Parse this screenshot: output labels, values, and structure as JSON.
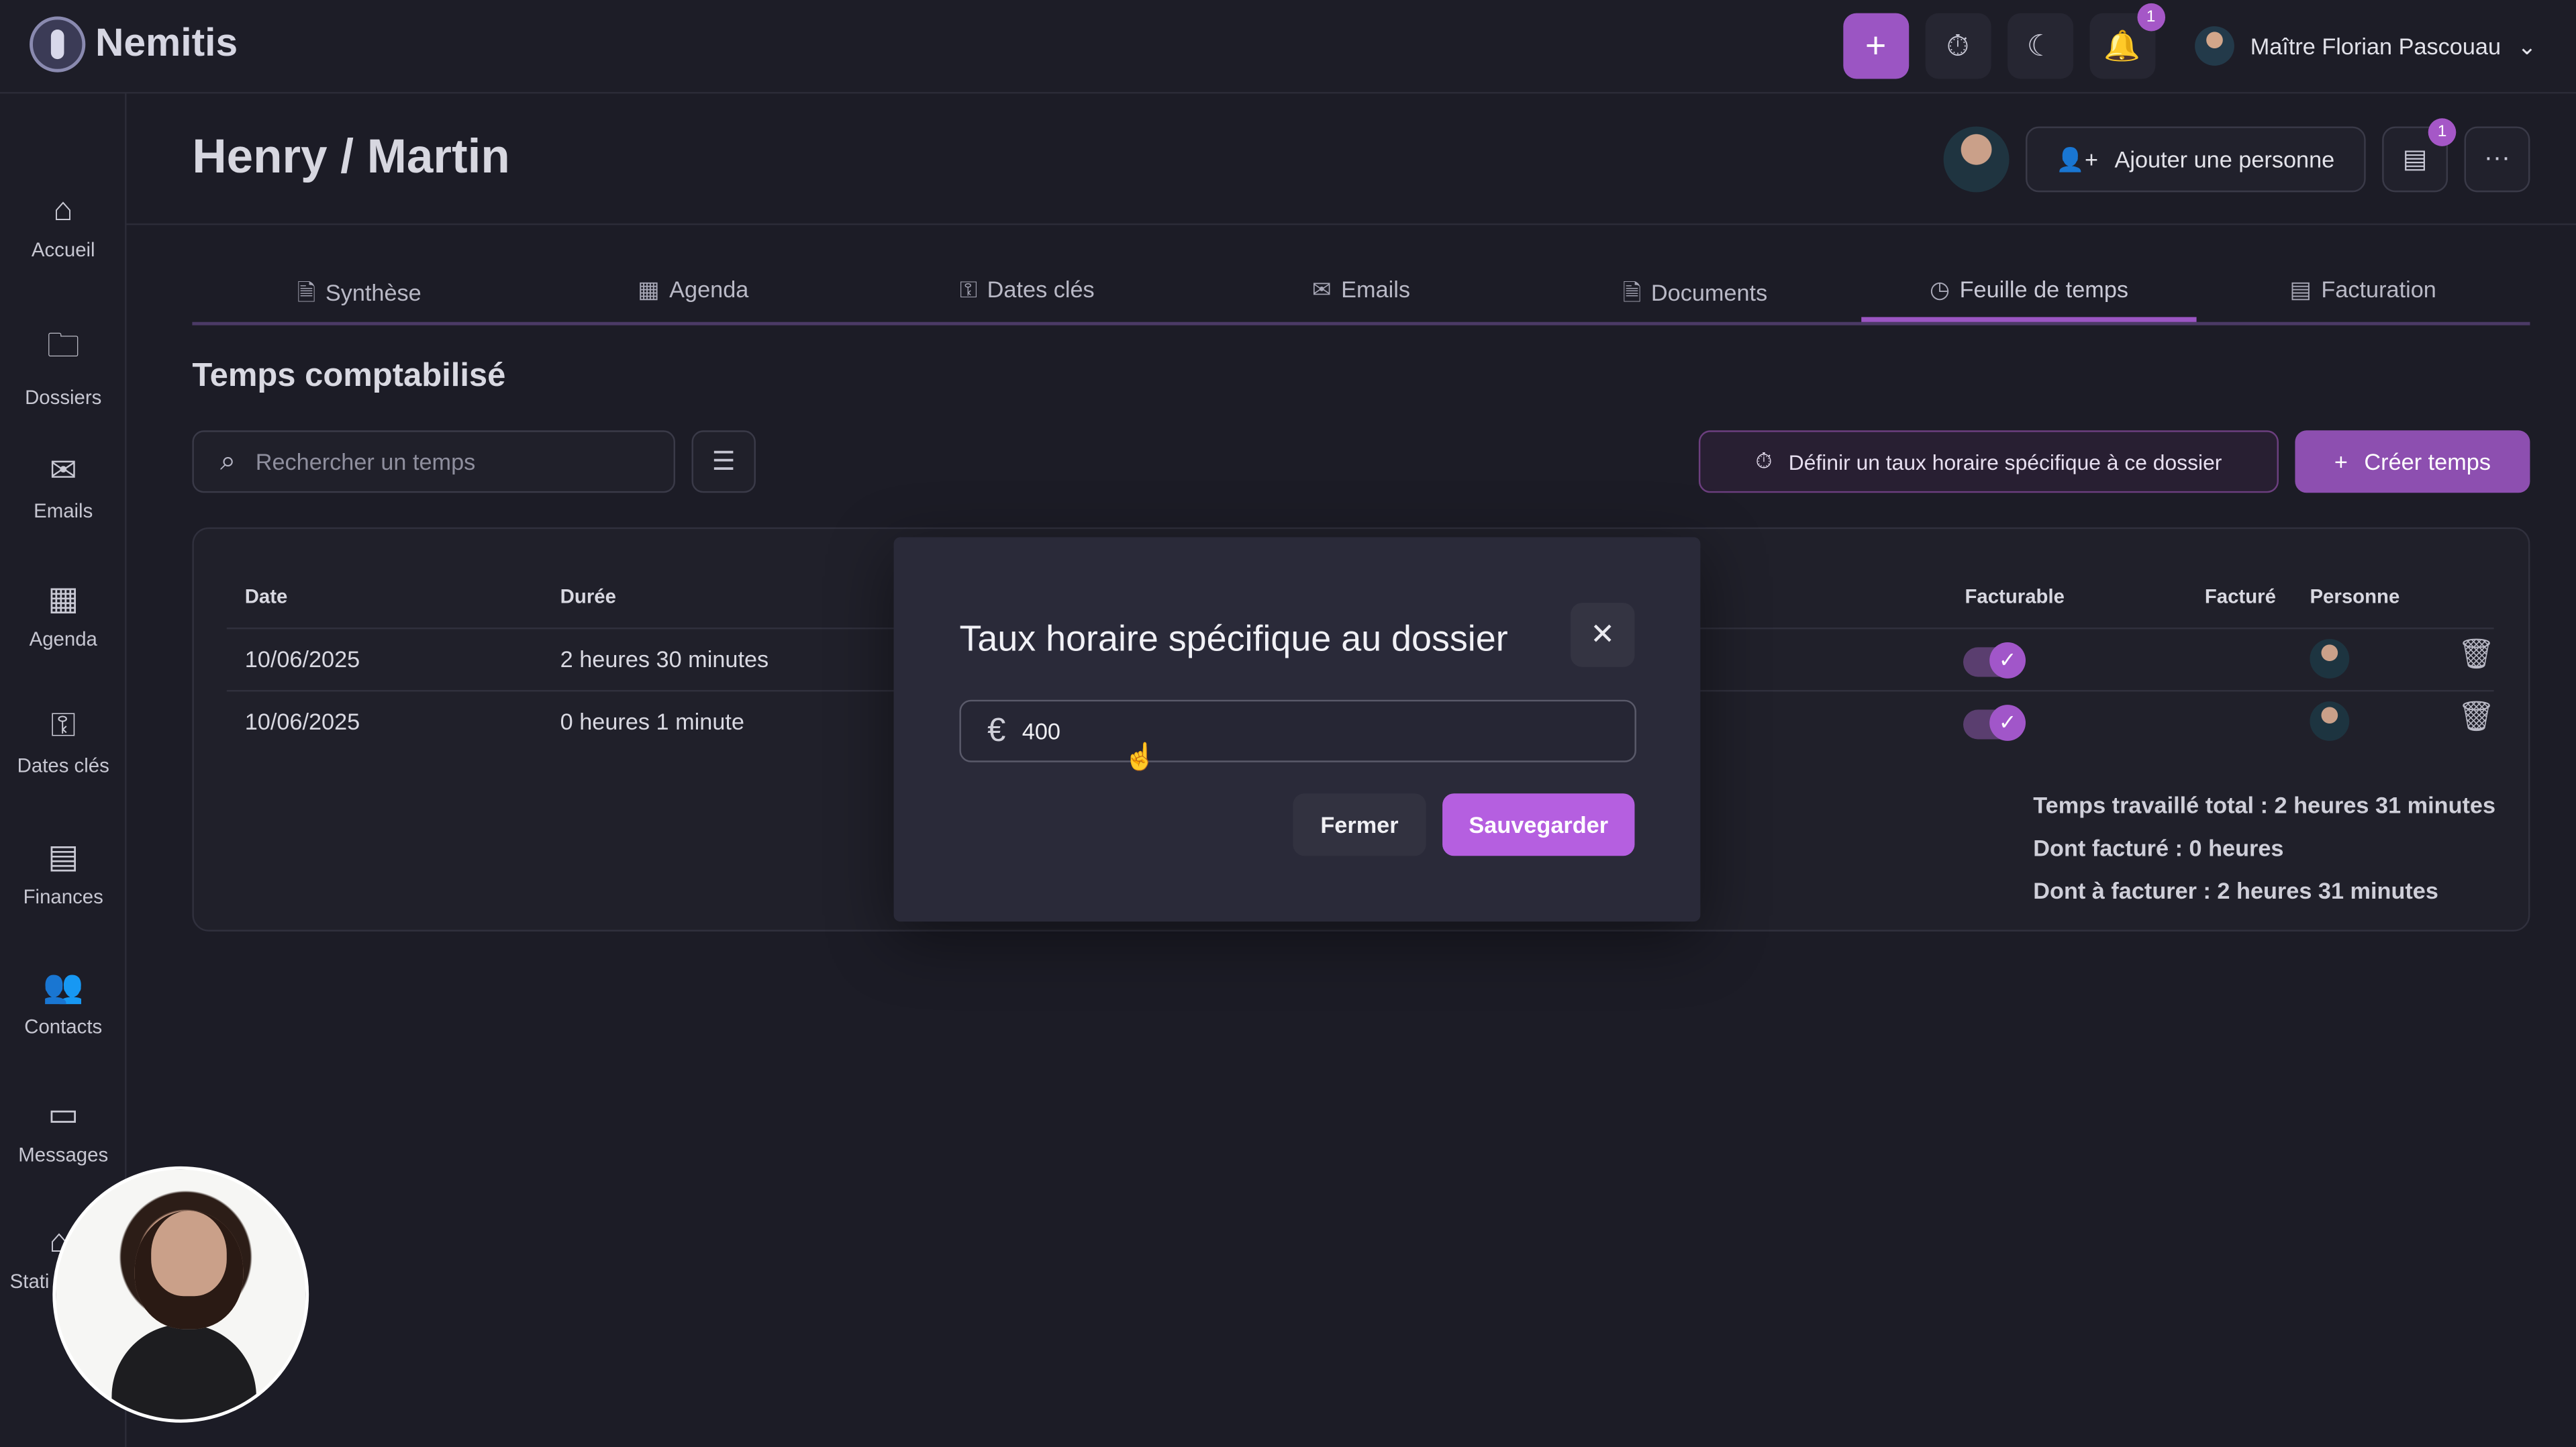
{
  "app": {
    "name": "Nemitis"
  },
  "topbar": {
    "user_name": "Maître Florian Pascouau",
    "notifications_count": "1"
  },
  "sidebar": {
    "items": [
      {
        "label": "Accueil"
      },
      {
        "label": "Dossiers"
      },
      {
        "label": "Emails"
      },
      {
        "label": "Agenda"
      },
      {
        "label": "Dates clés"
      },
      {
        "label": "Finances"
      },
      {
        "label": "Contacts"
      },
      {
        "label": "Messages"
      },
      {
        "label": "Stati"
      }
    ]
  },
  "page": {
    "title": "Henry / Martin",
    "add_person": "Ajouter une personne",
    "messages_count": "1",
    "tabs": [
      {
        "label": "Synthèse"
      },
      {
        "label": "Agenda"
      },
      {
        "label": "Dates clés"
      },
      {
        "label": "Emails"
      },
      {
        "label": "Documents"
      },
      {
        "label": "Feuille de temps"
      },
      {
        "label": "Facturation"
      }
    ]
  },
  "time_section": {
    "title": "Temps comptabilisé",
    "search_placeholder": "Rechercher un temps",
    "rate_button": "Définir un taux horaire spécifique à ce dossier",
    "create_button": "Créer temps",
    "columns": {
      "date": "Date",
      "duration": "Durée",
      "billable": "Facturable",
      "billed": "Facturé",
      "person": "Personne"
    },
    "rows": [
      {
        "date": "10/06/2025",
        "duration": "2 heures 30 minutes"
      },
      {
        "date": "10/06/2025",
        "duration": "0 heures 1 minute"
      }
    ],
    "totals": {
      "worked": "Temps travaillé total : 2 heures 31 minutes",
      "billed": "Dont facturé : 0 heures",
      "to_bill": "Dont à facturer : 2 heures 31 minutes"
    }
  },
  "modal": {
    "title": "Taux horaire spécifique au dossier",
    "amount": "400",
    "close_label": "Fermer",
    "save_label": "Sauvegarder"
  },
  "colors": {
    "accent": "#9b55c3",
    "save_button": "#b55fe0",
    "background": "#1c1c26"
  }
}
